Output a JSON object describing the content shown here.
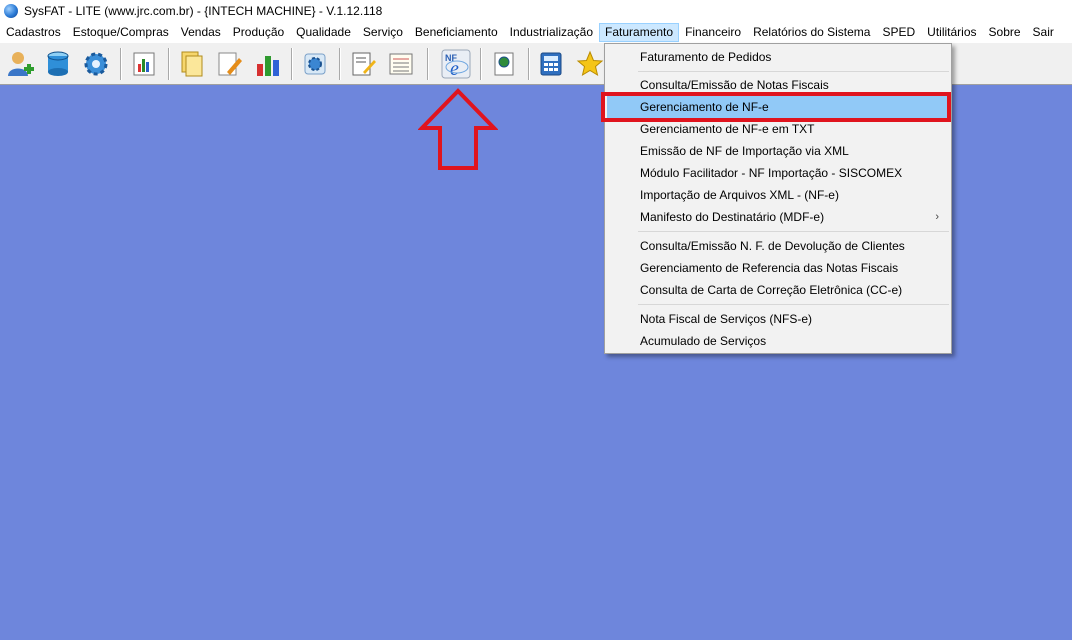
{
  "window": {
    "title": "SysFAT - LITE (www.jrc.com.br) - {INTECH MACHINE} - V.1.12.118"
  },
  "menubar": {
    "items": [
      "Cadastros",
      "Estoque/Compras",
      "Vendas",
      "Produção",
      "Qualidade",
      "Serviço",
      "Beneficiamento",
      "Industrialização",
      "Faturamento",
      "Financeiro",
      "Relatórios do Sistema",
      "SPED",
      "Utilitários",
      "Sobre",
      "Sair"
    ],
    "active": "Faturamento"
  },
  "toolbar": {
    "icons": [
      "user-add-icon",
      "database-icon",
      "settings-gear-icon",
      "chart-book-icon",
      "documents-icon",
      "edit-document-icon",
      "bar-chart-icon",
      "gear-blue-icon",
      "write-document-icon",
      "report-list-icon",
      "nfe-icon",
      "globe-document-icon",
      "calculator-icon",
      "star-icon"
    ]
  },
  "dropdown": {
    "items": [
      "Faturamento de Pedidos",
      "Consulta/Emissão de Notas Fiscais",
      "Gerenciamento de NF-e",
      "Gerenciamento de NF-e em TXT",
      "Emissão de NF de Importação via XML",
      "Módulo Facilitador - NF Importação - SISCOMEX",
      "Importação de Arquivos XML - (NF-e)",
      "Manifesto do Destinatário (MDF-e)",
      "Consulta/Emissão N. F. de Devolução de Clientes",
      "Gerenciamento de Referencia das Notas Fiscais",
      "Consulta de Carta de Correção Eletrônica (CC-e)",
      "Nota Fiscal de Serviços (NFS-e)",
      "Acumulado de Serviços"
    ],
    "highlighted": "Gerenciamento de NF-e",
    "submenu_indicator": "›"
  },
  "colors": {
    "workspace": "#6e86dc",
    "highlight": "#91c9f7",
    "annotation": "#e0141e"
  }
}
